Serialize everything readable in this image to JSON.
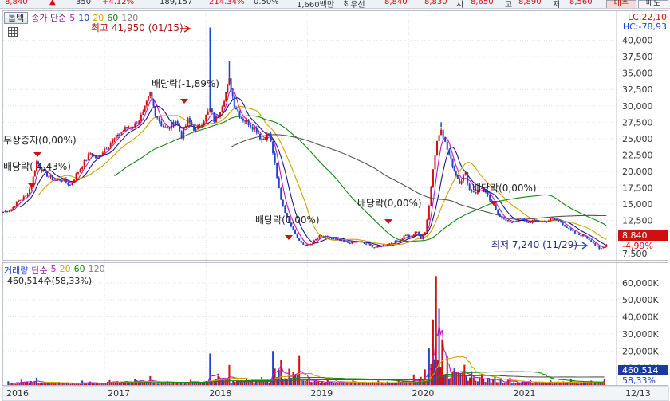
{
  "header": {
    "price": "8,840",
    "change": "350",
    "change_pct": "+4.12%",
    "volume": "189,157",
    "vol_ratio": "214.34%",
    "turnover": "0.50%",
    "amount": "1,660백만",
    "best_ask_label": "최우선",
    "ask": "8,840",
    "bid": "8,830",
    "open_label": "시",
    "open": "8,650",
    "high_label": "고",
    "high": "8,890",
    "low_label": "저",
    "low": "8,560",
    "buy_label": "매수",
    "sell_label": "매도"
  },
  "toolbar": {
    "tool_button": "톱텍",
    "indicator": "종가 단순",
    "ma_labels": [
      "5",
      "10",
      "20",
      "60",
      "120"
    ]
  },
  "price_pane": {
    "lc": "LC:22,10",
    "hc": "HC:-78,93",
    "current_price": "8,840",
    "current_change": "-4,99%",
    "high_marker": "최고 41,950 (01/15)",
    "low_marker": "최저 7,240 (11/29)",
    "annotations": [
      {
        "text": "무상증자(0,00%)"
      },
      {
        "text": "배당락(-4,43%)"
      },
      {
        "text": "배당락(-1,89%)"
      },
      {
        "text": "배당락(0,00%)"
      },
      {
        "text": "배당락(0,00%)"
      },
      {
        "text": "배당락(0,00%)"
      }
    ]
  },
  "volume_pane": {
    "title": "거래량",
    "indicator": "단순",
    "ma_labels": [
      "5",
      "20",
      "60",
      "120"
    ],
    "summary": "460,514주(58,33%)",
    "current_volume": "460,514",
    "current_pct": "58,33%"
  },
  "colors": {
    "up": "#d01010",
    "down": "#2040d0",
    "ma5": "#c018c0",
    "ma10": "#1a1a80",
    "ma20": "#d4a000",
    "ma60": "#108a10",
    "ma120": "#555555"
  },
  "chart_data": [
    {
      "type": "candlestick",
      "title": "",
      "y_ticks": [
        "7,500",
        "10,000",
        "12,500",
        "15,000",
        "17,500",
        "20,000",
        "22,500",
        "25,000",
        "27,500",
        "30,000",
        "32,500",
        "35,000",
        "37,500",
        "40,000"
      ],
      "y_tick_values": [
        7500,
        10000,
        12500,
        15000,
        17500,
        20000,
        22500,
        25000,
        27500,
        30000,
        32500,
        35000,
        37500,
        40000
      ],
      "ylim": [
        6500,
        42500
      ],
      "x_ticks": [
        "2016",
        "2017",
        "2018",
        "2019",
        "2020",
        "2021",
        "12/13"
      ],
      "x_tick_values": [
        2016.0,
        2017.0,
        2018.0,
        2019.0,
        2020.0,
        2021.0,
        2021.95
      ],
      "xlim": [
        2016.0,
        2022.05
      ],
      "grid": true,
      "close": [
        [
          2016.0,
          13800
        ],
        [
          2016.08,
          14200
        ],
        [
          2016.15,
          15500
        ],
        [
          2016.22,
          16200
        ],
        [
          2016.28,
          17900
        ],
        [
          2016.33,
          21500
        ],
        [
          2016.38,
          20300
        ],
        [
          2016.45,
          19200
        ],
        [
          2016.52,
          18600
        ],
        [
          2016.58,
          18800
        ],
        [
          2016.66,
          17900
        ],
        [
          2016.72,
          19500
        ],
        [
          2016.8,
          21400
        ],
        [
          2016.86,
          22800
        ],
        [
          2016.93,
          21900
        ],
        [
          2017.0,
          23500
        ],
        [
          2017.08,
          24600
        ],
        [
          2017.15,
          25800
        ],
        [
          2017.22,
          26700
        ],
        [
          2017.3,
          27100
        ],
        [
          2017.38,
          28800
        ],
        [
          2017.45,
          31800
        ],
        [
          2017.5,
          28900
        ],
        [
          2017.56,
          27200
        ],
        [
          2017.62,
          26400
        ],
        [
          2017.7,
          27800
        ],
        [
          2017.76,
          25400
        ],
        [
          2017.82,
          27800
        ],
        [
          2017.9,
          26200
        ],
        [
          2017.96,
          27500
        ],
        [
          2018.04,
          29400
        ],
        [
          2018.08,
          27800
        ],
        [
          2018.12,
          28600
        ],
        [
          2018.18,
          31200
        ],
        [
          2018.23,
          33800
        ],
        [
          2018.28,
          30200
        ],
        [
          2018.35,
          28200
        ],
        [
          2018.42,
          27400
        ],
        [
          2018.5,
          26300
        ],
        [
          2018.55,
          24800
        ],
        [
          2018.62,
          25800
        ],
        [
          2018.66,
          22900
        ],
        [
          2018.7,
          18900
        ],
        [
          2018.74,
          15800
        ],
        [
          2018.8,
          12900
        ],
        [
          2018.86,
          11200
        ],
        [
          2018.92,
          9400
        ],
        [
          2018.98,
          8600
        ],
        [
          2019.05,
          9100
        ],
        [
          2019.12,
          10100
        ],
        [
          2019.2,
          9900
        ],
        [
          2019.3,
          9500
        ],
        [
          2019.4,
          9100
        ],
        [
          2019.5,
          9300
        ],
        [
          2019.58,
          8900
        ],
        [
          2019.66,
          8400
        ],
        [
          2019.75,
          8700
        ],
        [
          2019.85,
          9200
        ],
        [
          2019.92,
          9600
        ],
        [
          2019.97,
          10400
        ],
        [
          2020.02,
          9800
        ],
        [
          2020.05,
          10400
        ],
        [
          2020.08,
          10900
        ],
        [
          2020.12,
          9700
        ],
        [
          2020.16,
          10700
        ],
        [
          2020.2,
          14900
        ],
        [
          2020.24,
          20500
        ],
        [
          2020.28,
          24600
        ],
        [
          2020.32,
          26800
        ],
        [
          2020.36,
          24300
        ],
        [
          2020.4,
          22400
        ],
        [
          2020.45,
          20200
        ],
        [
          2020.5,
          18400
        ],
        [
          2020.56,
          19600
        ],
        [
          2020.6,
          17200
        ],
        [
          2020.66,
          16800
        ],
        [
          2020.72,
          17600
        ],
        [
          2020.78,
          16100
        ],
        [
          2020.84,
          14700
        ],
        [
          2020.9,
          13200
        ],
        [
          2020.96,
          12400
        ],
        [
          2021.02,
          12300
        ],
        [
          2021.1,
          12700
        ],
        [
          2021.18,
          12200
        ],
        [
          2021.26,
          12500
        ],
        [
          2021.34,
          12300
        ],
        [
          2021.42,
          12800
        ],
        [
          2021.5,
          12300
        ],
        [
          2021.58,
          11100
        ],
        [
          2021.66,
          10400
        ],
        [
          2021.74,
          10100
        ],
        [
          2021.82,
          9100
        ],
        [
          2021.88,
          8100
        ],
        [
          2021.92,
          8400
        ],
        [
          2021.95,
          8840
        ]
      ],
      "spikes": [
        {
          "x": 2018.04,
          "high": 41950
        },
        {
          "x": 2018.23,
          "high": 36800
        },
        {
          "x": 2020.32,
          "high": 27500
        }
      ]
    },
    {
      "type": "bar",
      "title": "",
      "y_ticks": [
        "10,000K",
        "20,000K",
        "30,000K",
        "40,000K",
        "50,000K",
        "60,000K"
      ],
      "y_tick_values": [
        10000,
        20000,
        30000,
        40000,
        50000,
        60000
      ],
      "ylim": [
        0,
        66000
      ],
      "unit": "K",
      "bars": [
        [
          2016.05,
          2200
        ],
        [
          2016.18,
          3100
        ],
        [
          2016.33,
          4300
        ],
        [
          2016.55,
          1800
        ],
        [
          2016.78,
          2600
        ],
        [
          2017.05,
          2900
        ],
        [
          2017.3,
          3500
        ],
        [
          2017.45,
          5200
        ],
        [
          2017.62,
          2400
        ],
        [
          2017.85,
          3100
        ],
        [
          2018.04,
          18500
        ],
        [
          2018.12,
          5400
        ],
        [
          2018.23,
          11800
        ],
        [
          2018.4,
          3800
        ],
        [
          2018.55,
          4600
        ],
        [
          2018.66,
          20000
        ],
        [
          2018.74,
          14500
        ],
        [
          2018.82,
          9600
        ],
        [
          2018.92,
          17500
        ],
        [
          2019.02,
          4200
        ],
        [
          2019.2,
          3200
        ],
        [
          2019.45,
          2900
        ],
        [
          2019.7,
          2600
        ],
        [
          2019.9,
          3100
        ],
        [
          2020.05,
          6200
        ],
        [
          2020.12,
          4800
        ],
        [
          2020.16,
          9200
        ],
        [
          2020.2,
          21500
        ],
        [
          2020.24,
          38500
        ],
        [
          2020.27,
          64000
        ],
        [
          2020.3,
          45200
        ],
        [
          2020.33,
          26800
        ],
        [
          2020.38,
          16800
        ],
        [
          2020.45,
          9800
        ],
        [
          2020.55,
          11900
        ],
        [
          2020.62,
          8100
        ],
        [
          2020.72,
          6400
        ],
        [
          2020.85,
          5200
        ],
        [
          2021.0,
          4300
        ],
        [
          2021.2,
          2900
        ],
        [
          2021.4,
          2700
        ],
        [
          2021.6,
          3400
        ],
        [
          2021.8,
          2600
        ],
        [
          2021.93,
          3600
        ]
      ]
    }
  ]
}
